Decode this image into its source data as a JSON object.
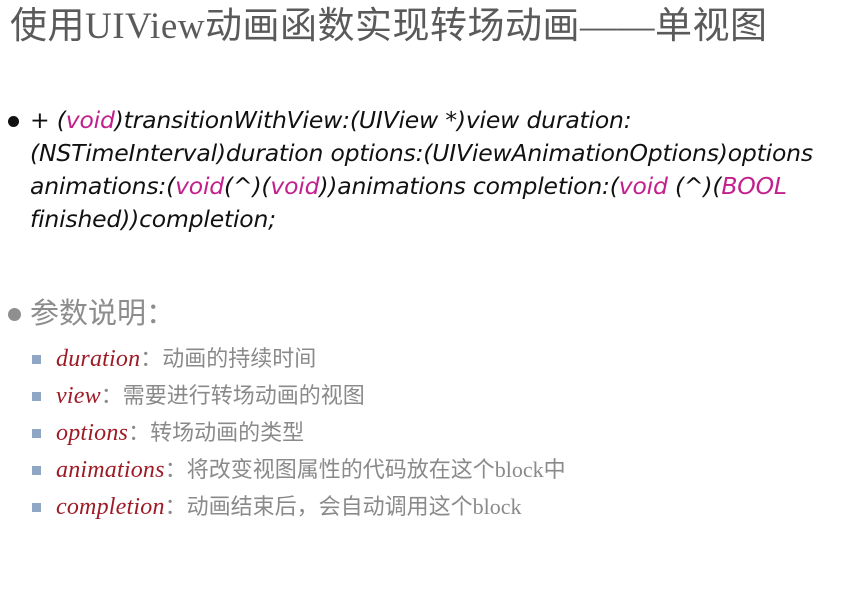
{
  "slide": {
    "title": "使用UIView动画函数实现转场动画——单视图",
    "colors": {
      "title": "#5a5a5a",
      "keyword_magenta": "#c2208c",
      "param_name_red": "#9e1b26",
      "description_gray": "#8a8a8a",
      "sub_bullet_blue": "#8fa6c4",
      "background": "#ffffff"
    },
    "code_block": {
      "bullet": "filled-circle-bullet",
      "lines": [
        {
          "segments": [
            {
              "text": "+ (",
              "kind": "plain"
            },
            {
              "text": "void",
              "kind": "keyword"
            },
            {
              "text": ")transitionWithView:(UIView *)view",
              "kind": "plain"
            }
          ]
        },
        {
          "segments": [
            {
              "text": "duration:(NSTimeInterval)duration",
              "kind": "plain"
            }
          ]
        },
        {
          "segments": [
            {
              "text": "options:(UIViewAnimationOptions)options animations:(",
              "kind": "plain"
            },
            {
              "text": "void",
              "kind": "keyword"
            }
          ]
        },
        {
          "segments": [
            {
              "text": "(^)(",
              "kind": "plain"
            },
            {
              "text": "void",
              "kind": "keyword"
            },
            {
              "text": "))animations completion:(",
              "kind": "plain"
            },
            {
              "text": "void",
              "kind": "keyword"
            },
            {
              "text": " (^)(",
              "kind": "plain"
            },
            {
              "text": "BOOL",
              "kind": "keyword"
            }
          ]
        },
        {
          "segments": [
            {
              "text": "finished))completion;",
              "kind": "plain"
            }
          ]
        }
      ],
      "full_text": "+ (void)transitionWithView:(UIView *)view duration:(NSTimeInterval)duration options:(UIViewAnimationOptions)options animations:(void (^)(void))animations completion:(void (^)(BOOL finished))completion;"
    },
    "params_section": {
      "bullet": "filled-circle-bullet",
      "heading": "参数说明：",
      "items": [
        {
          "name": "duration",
          "separator": "：",
          "desc": "动画的持续时间"
        },
        {
          "name": "view",
          "separator": "：",
          "desc": "需要进行转场动画的视图"
        },
        {
          "name": "options",
          "separator": "：",
          "desc": "转场动画的类型"
        },
        {
          "name": "animations",
          "separator": "：",
          "desc_pre": "将改变视图属性的代码放在这个",
          "desc_en": "block",
          "desc_post": "中"
        },
        {
          "name": "completion",
          "separator": "：",
          "desc_pre": "动画结束后，会自动调用这个",
          "desc_en": "block",
          "desc_post": ""
        }
      ]
    }
  }
}
